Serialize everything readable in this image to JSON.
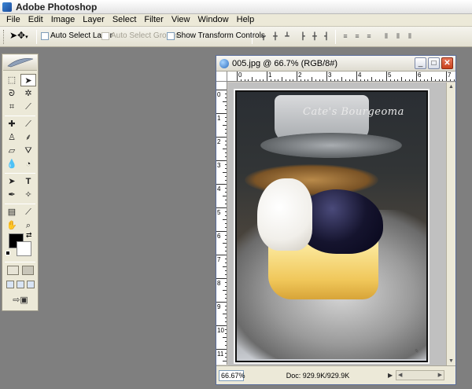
{
  "app": {
    "title": "Adobe Photoshop"
  },
  "menubar": {
    "items": [
      "File",
      "Edit",
      "Image",
      "Layer",
      "Select",
      "Filter",
      "View",
      "Window",
      "Help"
    ]
  },
  "options": {
    "auto_select_layer": "Auto Select Layer",
    "auto_select_groups": "Auto Select Groups",
    "show_transform_controls": "Show Transform Controls"
  },
  "colors": {
    "foreground": "#000000",
    "background": "#ffffff",
    "workspace": "#7f7f7f"
  },
  "document": {
    "title": "005.jpg @ 66.7% (RGB/8#)",
    "zoom": "66.67%",
    "doc_info": "Doc: 929.9K/929.9K",
    "watermark": "Cate's Bourgeoma",
    "window_buttons": {
      "minimize": "_",
      "maximize": "□",
      "close": "✕"
    }
  },
  "rulers": {
    "horizontal": [
      "0",
      "1",
      "2",
      "3",
      "4",
      "5",
      "6",
      "7"
    ],
    "vertical": [
      "0",
      "1",
      "2",
      "3",
      "4",
      "5",
      "6",
      "7",
      "8",
      "9",
      "10",
      "11"
    ]
  }
}
